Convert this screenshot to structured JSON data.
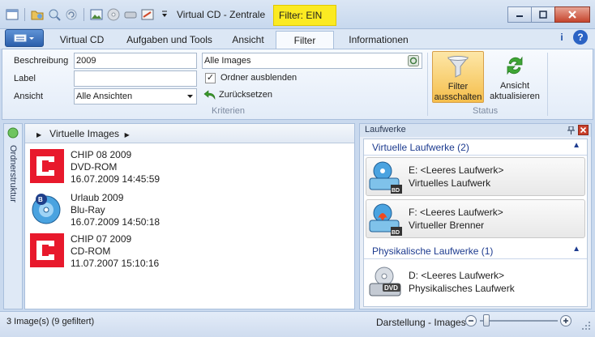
{
  "window": {
    "title": "Virtual CD - Zentrale",
    "filter_badge": "Filter: EIN",
    "quick_access_icons": [
      "layout-icon",
      "folder-icon",
      "search-icon",
      "refresh-icon",
      "image-icon",
      "disc-icon",
      "drive-icon",
      "settings-icon",
      "dropdown-icon"
    ],
    "controls": [
      "minimize-icon",
      "maximize-icon",
      "close-icon"
    ]
  },
  "ribbon": {
    "tabs": [
      "Virtual CD",
      "Aufgaben und Tools",
      "Ansicht",
      "Filter",
      "Informationen"
    ],
    "active_tab": "Filter",
    "help_icons": [
      "info-icon",
      "help-icon"
    ],
    "criteria": {
      "description_label": "Beschreibung",
      "description_value": "2009",
      "label_label": "Label",
      "label_value": "",
      "view_label": "Ansicht",
      "view_value": "Alle Ansichten",
      "images_value": "Alle Images",
      "hide_folders_label": "Ordner ausblenden",
      "hide_folders_checked": true,
      "reset_label": "Zurücksetzen",
      "group_label": "Kriterien"
    },
    "status_group": {
      "filter_off_line1": "Filter",
      "filter_off_line2": "ausschalten",
      "update_line1": "Ansicht",
      "update_line2": "aktualisieren",
      "group_label": "Status"
    }
  },
  "sidebar": {
    "label": "Ordnerstruktur"
  },
  "images_panel": {
    "breadcrumb": "Virtuelle Images",
    "items": [
      {
        "icon": "chip-logo-icon",
        "name": "CHIP 08 2009",
        "type": "DVD-ROM",
        "date": "16.07.2009 14:45:59"
      },
      {
        "icon": "bluray-disc-icon",
        "name": "Urlaub 2009",
        "type": "Blu-Ray",
        "date": "16.07.2009 14:50:18"
      },
      {
        "icon": "chip-logo-icon",
        "name": "CHIP 07 2009",
        "type": "CD-ROM",
        "date": "11.07.2007 15:10:16"
      }
    ]
  },
  "drives_panel": {
    "title": "Laufwerke",
    "virtual_section": "Virtuelle Laufwerke (2)",
    "virtual_drives": [
      {
        "icon": "bd-drive-icon",
        "name": "E: <Leeres Laufwerk>",
        "type": "Virtuelles Laufwerk"
      },
      {
        "icon": "bd-burner-icon",
        "name": "F: <Leeres Laufwerk>",
        "type": "Virtueller Brenner"
      }
    ],
    "physical_section": "Physikalische Laufwerke (1)",
    "physical_drives": [
      {
        "icon": "dvd-drive-icon",
        "name": "D: <Leeres Laufwerk>",
        "type": "Physikalisches Laufwerk"
      }
    ]
  },
  "statusbar": {
    "count_text": "3 Image(s) (9 gefiltert)",
    "view_label": "Darstellung - Images",
    "zoom_level": 0.05
  },
  "colors": {
    "filter_badge": "#fbea22",
    "chip_red": "#e8192c",
    "section_blue": "#1d3b8f",
    "active_button": "#f5be4b"
  }
}
